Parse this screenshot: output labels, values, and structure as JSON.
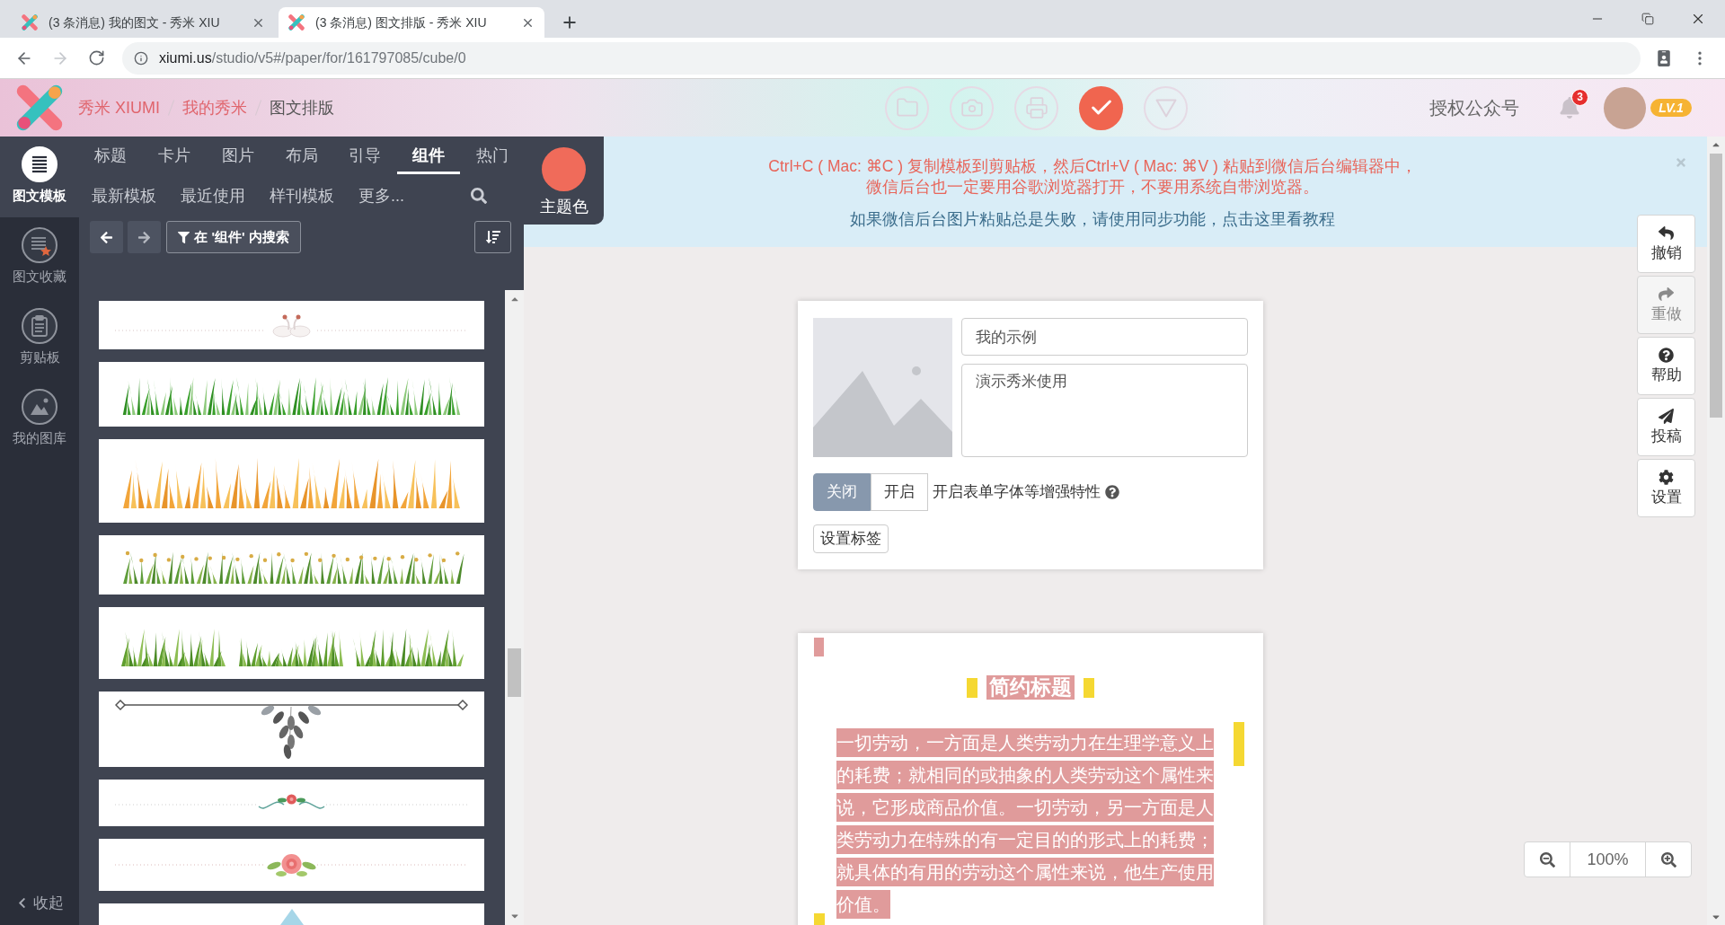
{
  "browser": {
    "tabs": [
      {
        "title": "(3 条消息) 我的图文 - 秀米 XIU",
        "selected": false
      },
      {
        "title": "(3 条消息) 图文排版 - 秀米 XIU",
        "selected": true
      }
    ],
    "nav": {
      "back_disabled": false,
      "forward_disabled": true
    },
    "url": {
      "host": "xiumi.us",
      "path": "/studio/v5#/paper/for/161797085/cube/0"
    }
  },
  "header": {
    "breadcrumb": [
      {
        "label": "秀米 XIUMI",
        "current": false
      },
      {
        "label": "我的秀米",
        "current": false
      },
      {
        "label": "图文排版",
        "current": true
      }
    ],
    "tools": [
      {
        "kind": "folder",
        "active": false
      },
      {
        "kind": "photo",
        "active": false
      },
      {
        "kind": "tray",
        "active": false
      },
      {
        "kind": "check",
        "active": true
      },
      {
        "kind": "triangle",
        "active": false
      }
    ],
    "account_link": "授权公众号",
    "notification_count": "3",
    "level_badge": "LV.1"
  },
  "sidebar": {
    "items": [
      {
        "kind": "templates",
        "label": "图文模板",
        "selected": true
      },
      {
        "kind": "favorites",
        "label": "图文收藏",
        "selected": false
      },
      {
        "kind": "clipboard",
        "label": "剪贴板",
        "selected": false
      },
      {
        "kind": "gallery",
        "label": "我的图库",
        "selected": false
      }
    ],
    "collapse": "收起"
  },
  "panel": {
    "tabs": [
      {
        "label": "标题",
        "selected": false
      },
      {
        "label": "卡片",
        "selected": false
      },
      {
        "label": "图片",
        "selected": false
      },
      {
        "label": "布局",
        "selected": false
      },
      {
        "label": "引导",
        "selected": false
      },
      {
        "label": "组件",
        "selected": true
      },
      {
        "label": "热门",
        "selected": false
      }
    ],
    "subtabs": [
      "最新模板",
      "最近使用",
      "样刊模板",
      "更多..."
    ],
    "theme": {
      "label": "主题色",
      "color": "#f06b5a"
    },
    "history": {
      "back_disabled": false,
      "forward_disabled": true
    },
    "filter_search": "在 '组件' 内搜索",
    "cards": [
      {
        "kind": "swan"
      },
      {
        "kind": "green-grass"
      },
      {
        "kind": "golden-grass"
      },
      {
        "kind": "wheat"
      },
      {
        "kind": "meadow"
      },
      {
        "kind": "leaf-divider"
      },
      {
        "kind": "floral-swirl"
      },
      {
        "kind": "rose"
      },
      {
        "kind": "triangle"
      }
    ]
  },
  "notice": {
    "lines": [
      {
        "kind": "warning",
        "text": "Ctrl+C ( Mac: ⌘C ) 复制模板到剪贴板，然后Ctrl+V ( Mac: ⌘V ) 粘贴到微信后台编辑器中，"
      },
      {
        "kind": "warning",
        "text": "微信后台也一定要用谷歌浏览器打开，不要用系统自带浏览器。"
      },
      {
        "kind": "link",
        "text": "如果微信后台图片粘贴总是失败，请使用同步功能，点击这里看教程"
      }
    ]
  },
  "form_card": {
    "title_value": "我的示例",
    "summary_value": "演示秀米使用",
    "toggle": [
      {
        "label": "关闭",
        "selected": true
      },
      {
        "label": "开启",
        "selected": false
      }
    ],
    "toggle_caption": "开启表单字体等增强特性",
    "tag_button": "设置标签"
  },
  "article": {
    "heading": "简约标题",
    "paragraph": "一切劳动，一方面是人类劳动力在生理学意义上的耗费；就相同的或抽象的人类劳动这个属性来说，它形成商品价值。一切劳动，另一方面是人类劳动力在特殊的有一定目的的形式上的耗费；就具体的有用的劳动这个属性来说，他生产使用价值。"
  },
  "side_actions": [
    {
      "kind": "undo",
      "label": "撤销",
      "disabled": false
    },
    {
      "kind": "redo",
      "label": "重做",
      "disabled": true
    },
    {
      "kind": "help",
      "label": "帮助",
      "disabled": false
    },
    {
      "kind": "submit",
      "label": "投稿",
      "disabled": false
    },
    {
      "kind": "settings",
      "label": "设置",
      "disabled": false
    }
  ],
  "zoom": {
    "value": "100%"
  }
}
